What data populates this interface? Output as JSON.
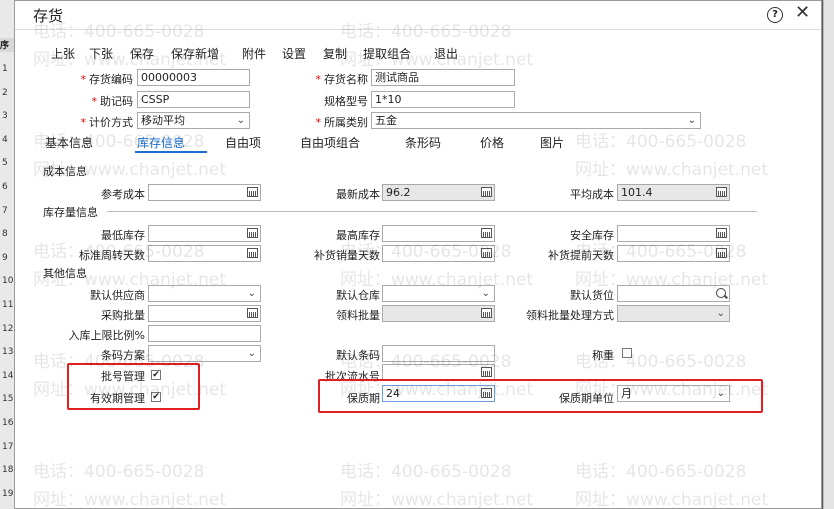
{
  "background_grid": {
    "header": "序号",
    "rows": [
      "1",
      "2",
      "3",
      "4",
      "5",
      "6",
      "7",
      "8",
      "9",
      "10",
      "11",
      "12",
      "13",
      "14",
      "15",
      "16",
      "17",
      "18",
      "19"
    ]
  },
  "dialog": {
    "title": "存货"
  },
  "toolbar": [
    "上张",
    "下张",
    "保存",
    "保存新增",
    "附件",
    "设置",
    "复制",
    "提取组合",
    "退出"
  ],
  "fields": {
    "code": {
      "label": "存货编码",
      "value": "00000003"
    },
    "name": {
      "label": "存货名称",
      "value": "测试商品"
    },
    "mnemonic": {
      "label": "助记码",
      "value": "CSSP"
    },
    "spec": {
      "label": "规格型号",
      "value": "1*10"
    },
    "costing": {
      "label": "计价方式",
      "value": "移动平均"
    },
    "category": {
      "label": "所属类别",
      "value": "五金"
    }
  },
  "tabs": [
    "基本信息",
    "库存信息",
    "自由项",
    "自由项组合",
    "条形码",
    "价格",
    "图片"
  ],
  "sections": {
    "cost": "成本信息",
    "stock": "库存量信息",
    "other": "其他信息"
  },
  "cost": {
    "ref": {
      "label": "参考成本",
      "value": ""
    },
    "latest": {
      "label": "最新成本",
      "value": "96.2"
    },
    "avg": {
      "label": "平均成本",
      "value": "101.4"
    }
  },
  "stock": {
    "min": {
      "label": "最低库存",
      "value": ""
    },
    "max": {
      "label": "最高库存",
      "value": ""
    },
    "safe": {
      "label": "安全库存",
      "value": ""
    },
    "turnover": {
      "label": "标准周转天数",
      "value": ""
    },
    "replenish_sales": {
      "label": "补货销量天数",
      "value": ""
    },
    "replenish_lead": {
      "label": "补货提前天数",
      "value": ""
    }
  },
  "other": {
    "supplier": {
      "label": "默认供应商",
      "value": ""
    },
    "warehouse": {
      "label": "默认仓库",
      "value": ""
    },
    "location": {
      "label": "默认货位",
      "value": ""
    },
    "purchase_batch": {
      "label": "采购批量",
      "value": ""
    },
    "picking_batch": {
      "label": "领料批量",
      "value": ""
    },
    "picking_batch_method": {
      "label": "领料批量处理方式",
      "value": ""
    },
    "inbound_ratio": {
      "label": "入库上限比例%",
      "value": ""
    },
    "barcode_scheme": {
      "label": "条码方案",
      "value": ""
    },
    "default_barcode": {
      "label": "默认条码",
      "value": ""
    },
    "weigh": {
      "label": "称重"
    },
    "batch_mgmt": {
      "label": "批号管理"
    },
    "batch_serial": {
      "label": "批次流水号",
      "value": ""
    },
    "expiry_mgmt": {
      "label": "有效期管理"
    },
    "shelf_life": {
      "label": "保质期",
      "value": "24"
    },
    "shelf_unit": {
      "label": "保质期单位",
      "value": "月"
    }
  },
  "checkmark": "✔",
  "watermarks": {
    "phone": "电话：400-665-0028",
    "site": "网址：www.chanjet.net"
  },
  "colors": {
    "accent": "#1a6fd0",
    "highlight": "#e02020"
  }
}
